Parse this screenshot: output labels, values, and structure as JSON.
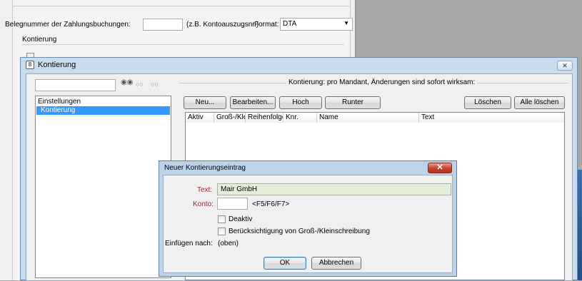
{
  "background_window": {
    "belegnummer_label": "Belegnummer der Zahlungsbuchungen:",
    "belegnummer_value": "",
    "belegnummer_hint": "(z.B. Kontoauszugsnr.)",
    "format_label": "Format:",
    "format_value": "DTA",
    "kontierung_label": "Kontierung"
  },
  "kontierung_dialog": {
    "title": "Kontierung",
    "search_value": "",
    "tree_items": [
      "Einstellungen",
      "Kontierung"
    ],
    "group_label": "Kontierung: pro Mandant, Änderungen sind sofort wirksam:",
    "buttons": {
      "neu": "Neu...",
      "bearbeiten": "Bearbeiten...",
      "hoch": "Hoch",
      "runter": "Runter",
      "loeschen": "Löschen",
      "alle_loeschen": "Alle löschen"
    },
    "columns": [
      "Aktiv",
      "Groß-/Kle",
      "Reihenfolge",
      "Knr.",
      "Name",
      "Text"
    ],
    "close_glyph": "✕"
  },
  "neuer_eintrag_dialog": {
    "title": "Neuer Kontierungseintrag",
    "close_glyph": "✕",
    "text_label": "Text:",
    "text_value": "Mair GmbH",
    "konto_label": "Konto:",
    "konto_value": "",
    "konto_hint": "<F5/F6/F7>",
    "deaktiv_label": "Deaktiv",
    "deaktiv_checked": false,
    "gross_klein_label": "Berücksichtigung von Groß-/Kleinschreibung",
    "gross_klein_checked": false,
    "einfuegen_label": "Einfügen nach:",
    "einfuegen_value": "(oben)",
    "ok": "OK",
    "abbrechen": "Abbrechen"
  },
  "colors": {
    "text_field_bg": "#e3efd9",
    "selection": "#3399ff",
    "label_red": "#a0222b"
  }
}
